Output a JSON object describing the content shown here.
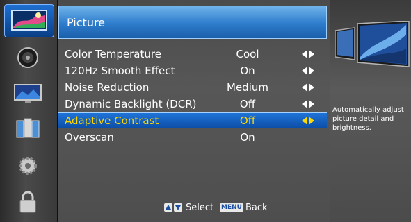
{
  "sidebar": {
    "items": [
      {
        "icon": "picture-icon"
      },
      {
        "icon": "audio-icon"
      },
      {
        "icon": "display-icon"
      },
      {
        "icon": "channel-icon"
      },
      {
        "icon": "settings-icon"
      },
      {
        "icon": "lock-icon"
      }
    ]
  },
  "header": {
    "title": "Picture"
  },
  "menu": {
    "items": [
      {
        "label": "Color Temperature",
        "value": "Cool",
        "arrows": true
      },
      {
        "label": "120Hz Smooth Effect",
        "value": "On",
        "arrows": true
      },
      {
        "label": "Noise Reduction",
        "value": "Medium",
        "arrows": true
      },
      {
        "label": "Dynamic Backlight (DCR)",
        "value": "Off",
        "arrows": true
      },
      {
        "label": "Adaptive Contrast",
        "value": "Off",
        "arrows": true,
        "selected": true
      },
      {
        "label": "Overscan",
        "value": "On",
        "arrows": false
      }
    ]
  },
  "footer": {
    "select_label": "Select",
    "menu_key": "MENU",
    "back_label": "Back"
  },
  "help": {
    "description": "Automatically adjust picture detail and brightness."
  },
  "colors": {
    "accent": "#1e6fd0",
    "selected_text": "#ffd800"
  }
}
